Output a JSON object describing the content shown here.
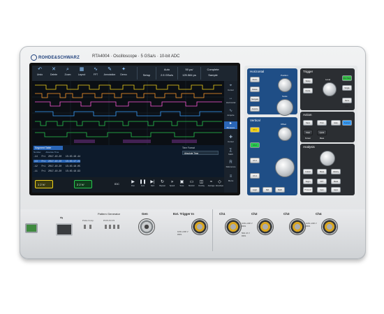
{
  "brand": "ROHDE&SCHWARZ",
  "model": "RTA4004 · Oscilloscope · 5 GSa/s · 10-bit ADC",
  "toolbar": [
    {
      "icon": "back-icon",
      "label": "Undo"
    },
    {
      "icon": "delete-icon",
      "label": "Delete"
    },
    {
      "icon": "search-icon",
      "label": "Zoom"
    },
    {
      "icon": "layout-icon",
      "label": "Layout"
    },
    {
      "icon": "fft-icon",
      "label": "FFT"
    },
    {
      "icon": "pen-icon",
      "label": "Annotation"
    },
    {
      "icon": "demo-icon",
      "label": "Demo"
    }
  ],
  "status": {
    "setup": "Setup",
    "mode": "Auto",
    "rate": "2.5 GSa/s",
    "timebase": "50 µs/",
    "length": "125.584 ps",
    "state": "Complete",
    "acq": "Sample"
  },
  "side_menu": [
    "Cursor",
    "Horizontal",
    "Acquire",
    "Measure",
    "Cursor",
    "Math",
    "Reference",
    "Menu"
  ],
  "table": {
    "tab_label": "Segment Table",
    "columns": [
      "Number",
      "Absolute Time"
    ],
    "rows": [
      "-14   Fri  2017-10-20   15:45:16.44",
      "-13   Fri  2017-10-20   15:45:17.21",
      "-12   Fri  2017-10-20   15:45:18.05",
      "-11   Fri  2017-10-20   15:45:18.93"
    ],
    "time_format_label": "Time Format",
    "time_format_value": "Absolute Time"
  },
  "bottom_bar": {
    "ch1": "1  2 V/",
    "ch2": "2  2 V/",
    "buttons": [
      "Run",
      "Auto",
      "Next",
      "Repeat",
      "Speed",
      "Save",
      "Monitor",
      "Overlay",
      "Average",
      "Envelope"
    ],
    "idc_label": "IDC"
  },
  "panel": {
    "horizontal_title": "Horizontal",
    "trigger_title": "Trigger",
    "vertical_title": "Vertical",
    "action_title": "Action",
    "analysis_title": "Analysis",
    "position_label": "Position",
    "scale_label": "Scale",
    "offset_label": "Offset",
    "level_label": "Level",
    "keys_h": [
      "Zoom",
      "Delete",
      "Navigate",
      "Acquire"
    ],
    "keys_trig": [
      "Run Stop",
      "Single",
      "Setup",
      "Force",
      "Norm Auto"
    ],
    "keys_v": [
      "Ch 1",
      "Ch 2",
      "Ch 3",
      "Ch 4"
    ],
    "keys_v_bottom": [
      "Logic",
      "Ref",
      "Math",
      "Protocol",
      "Gen",
      "Apps"
    ],
    "keys_action": [
      "Save Recall",
      "Print",
      "Help",
      "Clear Screen",
      "Quick Meas",
      "Autoset"
    ],
    "keys_analysis": [
      "Cursor",
      "Meas",
      "History",
      "Segm",
      "FFT",
      "Mask"
    ]
  },
  "front": {
    "pattern_generator": "Pattern Generator",
    "probe_comp": "Probe Comp.",
    "pins": "P0 P1 P2 P3",
    "gen": "Gen",
    "ext_trigger": "Ext. Trigger In",
    "ext_spec": "1MΩ ≤300 V RMS",
    "channels": [
      "Ch1",
      "Ch2",
      "Ch3",
      "Ch4"
    ],
    "ch_spec": "1MΩ ≤300 V RMS",
    "chx_spec": "50Ω ≤5 V RMS"
  },
  "colors": {
    "ch1": "#f2d21b",
    "ch2": "#28c850",
    "ch3": "#ff9a2a",
    "ch4": "#3aa0ff",
    "accent": "#1f4e86"
  }
}
